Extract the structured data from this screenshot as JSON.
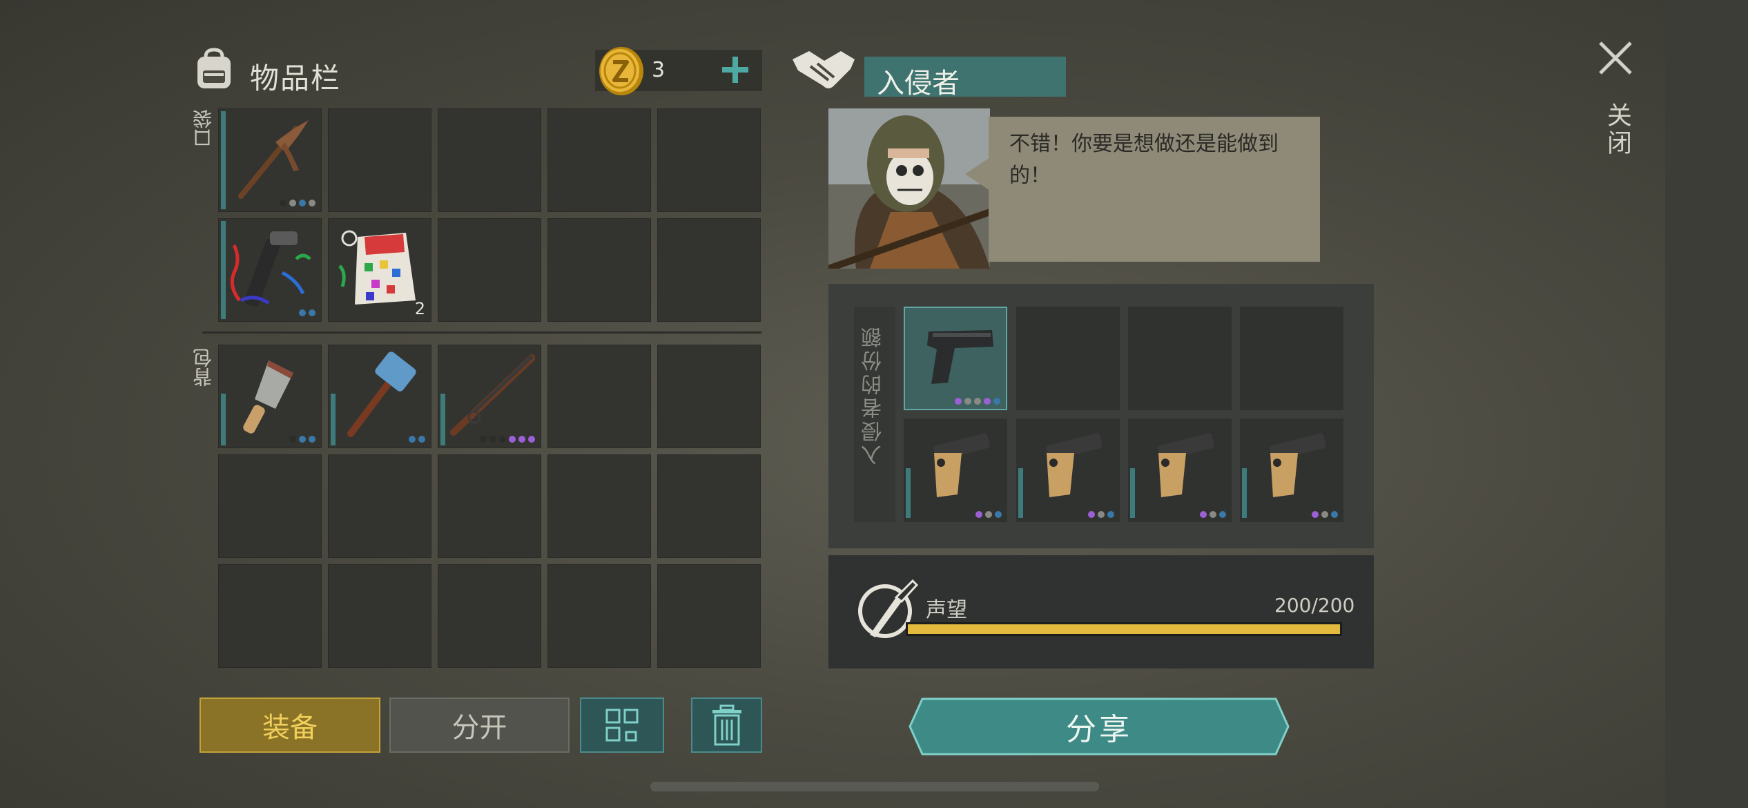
{
  "inventory": {
    "title": "物品栏",
    "coins": "3",
    "pocket_label": "口袋",
    "backpack_label": "背包"
  },
  "pocket_slots": [
    {
      "item": "pickaxe-icon",
      "dots": [
        "#2c2d29",
        "#8a8a84",
        "#3a78a8",
        "#8a8a84"
      ]
    },
    {
      "item": "empty"
    },
    {
      "item": "empty"
    },
    {
      "item": "empty"
    },
    {
      "item": "empty"
    },
    {
      "item": "party-popper-icon",
      "dots": [
        "#3a78a8",
        "#3a78a8"
      ]
    },
    {
      "item": "confetti-pack-icon",
      "qty": "2",
      "timer": true
    },
    {
      "item": "empty"
    },
    {
      "item": "empty"
    },
    {
      "item": "empty"
    }
  ],
  "backpack_slots": [
    {
      "item": "cleaver-icon",
      "dots": [
        "#2c2d29",
        "#3a78a8",
        "#3a78a8"
      ]
    },
    {
      "item": "sledgehammer-icon",
      "dots": [
        "#3a78a8",
        "#3a78a8"
      ]
    },
    {
      "item": "shotgun-icon",
      "dots": [
        "#2c2d29",
        "#2c2d29",
        "#2c2d29",
        "#9b5fd6",
        "#9b5fd6",
        "#9b5fd6"
      ]
    }
  ],
  "buttons": {
    "equip": "装备",
    "split": "分开",
    "share": "分享"
  },
  "trader": {
    "name": "入侵者",
    "speech": "不错！你要是想做还是能做到的！",
    "quota_label": "入侵者的份额"
  },
  "quota_slots": [
    {
      "item": "pistol-icon",
      "selected": true,
      "dots": [
        "#9b5fd6",
        "#8a8a84",
        "#8a8a84",
        "#9b5fd6",
        "#3a78a8"
      ]
    },
    {
      "item": "empty"
    },
    {
      "item": "empty"
    },
    {
      "item": "empty"
    },
    {
      "item": "flare-gun-icon",
      "dots": [
        "#9b5fd6",
        "#8a8a84",
        "#3a78a8"
      ]
    },
    {
      "item": "flare-gun-icon",
      "dots": [
        "#9b5fd6",
        "#8a8a84",
        "#3a78a8"
      ]
    },
    {
      "item": "flare-gun-icon",
      "dots": [
        "#9b5fd6",
        "#8a8a84",
        "#3a78a8"
      ]
    },
    {
      "item": "flare-gun-icon",
      "dots": [
        "#9b5fd6",
        "#8a8a84",
        "#3a78a8"
      ]
    }
  ],
  "reputation": {
    "label": "声望",
    "value_text": "200/200",
    "fraction": 1.0
  },
  "close_label": "关闭",
  "colors": {
    "accent_teal": "#3e7c7c",
    "equip_gold": "#8a7226",
    "rep_yellow": "#e3b93e",
    "rarity_blue": "#3a78a8",
    "rarity_purple": "#9b5fd6"
  }
}
